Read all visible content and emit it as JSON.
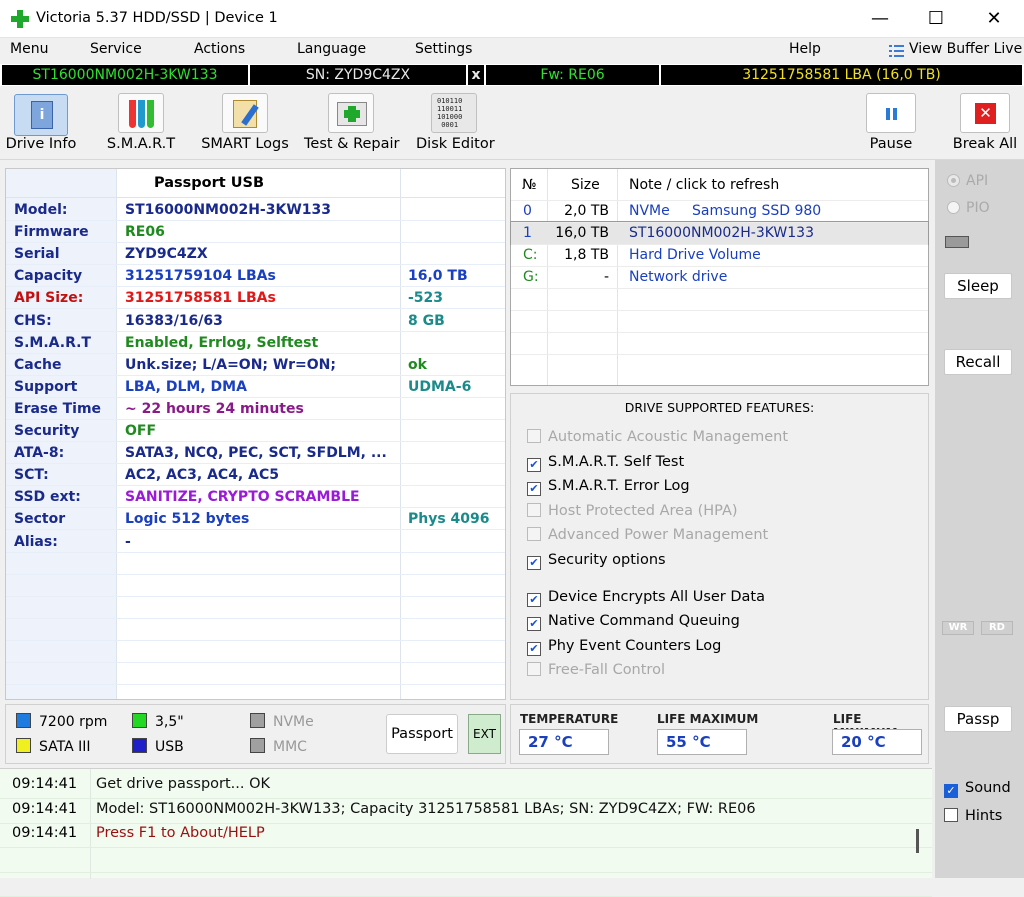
{
  "window": {
    "title": "Victoria 5.37 HDD/SSD | Device 1",
    "minimize": "—",
    "maximize": "☐",
    "close": "✕"
  },
  "menu": {
    "items": [
      "Menu",
      "Service",
      "Actions",
      "Language",
      "Settings",
      "Help"
    ],
    "view_buffer": "View Buffer Live"
  },
  "drive_strip": {
    "model": "ST16000NM002H-3KW133",
    "serial": "SN: ZYD9C4ZX",
    "close": "x",
    "firmware": "Fw: RE06",
    "capacity": "31251758581 LBA (16,0 TB)"
  },
  "toolbar": {
    "drive_info": "Drive Info",
    "smart": "S.M.A.R.T",
    "smart_logs": "SMART Logs",
    "test_repair": "Test & Repair",
    "disk_editor": "Disk Editor",
    "disk_editor_icon_text": "010110\n110011\n101000\n0001",
    "pause": "Pause",
    "break_all": "Break All"
  },
  "passport": {
    "header": "Passport USB",
    "rows": [
      {
        "key": "Model:",
        "value": "ST16000NM002H-3KW133",
        "extra": "",
        "color": "#1a2a8a",
        "extra_color": "#1a2a8a"
      },
      {
        "key": "Firmware",
        "value": "RE06",
        "extra": "",
        "color": "#1f8a1f",
        "extra_color": "#1a2a8a"
      },
      {
        "key": "Serial",
        "value": "ZYD9C4ZX",
        "extra": "",
        "color": "#1a2a8a",
        "extra_color": "#1a2a8a"
      },
      {
        "key": "Capacity",
        "value": "31251759104 LBAs",
        "extra": "16,0 TB",
        "color": "#1a3fbf",
        "extra_color": "#1a3fbf"
      },
      {
        "key": "API Size:",
        "value": "31251758581 LBAs",
        "extra": "-523",
        "color": "#e01818",
        "extra_color": "#1a8a8a",
        "key_color": "#c01010"
      },
      {
        "key": "CHS:",
        "value": "16383/16/63",
        "extra": "8 GB",
        "color": "#1a2a8a",
        "extra_color": "#1a8a8a"
      },
      {
        "key": "S.M.A.R.T",
        "value": "Enabled, Errlog, Selftest",
        "extra": "",
        "color": "#1f8a1f",
        "extra_color": "#1a2a8a"
      },
      {
        "key": "Cache",
        "value": "Unk.size; L/A=ON; Wr=ON;",
        "extra": "ok",
        "color": "#1a2a8a",
        "extra_color": "#1f8a1f"
      },
      {
        "key": "Support",
        "value": "LBA, DLM, DMA",
        "extra": "UDMA-6",
        "color": "#1a3fbf",
        "extra_color": "#1a8a8a"
      },
      {
        "key": "Erase Time",
        "value": "~ 22 hours 24 minutes",
        "extra": "",
        "color": "#8a1a8a",
        "extra_color": "#1a2a8a"
      },
      {
        "key": "Security",
        "value": "OFF",
        "extra": "",
        "color": "#1f8a1f",
        "extra_color": "#1a2a8a"
      },
      {
        "key": "ATA-8:",
        "value": "SATA3, NCQ, PEC, SCT, SFDLM, ...",
        "extra": "",
        "color": "#1a2a8a",
        "extra_color": "#1a2a8a"
      },
      {
        "key": "SCT:",
        "value": "AC2, AC3, AC4, AC5",
        "extra": "",
        "color": "#1a2a8a",
        "extra_color": "#1a2a8a"
      },
      {
        "key": "SSD ext:",
        "value": "SANITIZE, CRYPTO SCRAMBLE",
        "extra": "",
        "color": "#9a1ad8",
        "extra_color": "#1a2a8a"
      },
      {
        "key": "Sector",
        "value": "Logic 512 bytes",
        "extra": "Phys 4096",
        "color": "#1a3fbf",
        "extra_color": "#1a8a8a"
      },
      {
        "key": "Alias:",
        "value": "-",
        "extra": "",
        "color": "#1a2a8a",
        "extra_color": "#1a2a8a"
      }
    ]
  },
  "drive_list": {
    "headers": [
      "№",
      "Size",
      "Note / click to refresh"
    ],
    "rows": [
      {
        "num": "0",
        "size": "2,0 TB",
        "note": "NVMe     Samsung SSD 980",
        "num_color": "#1a3fbf",
        "note_color": "#1a3fbf"
      },
      {
        "num": "1",
        "size": "16,0 TB",
        "note": "ST16000NM002H-3KW133",
        "num_color": "#1a3fbf",
        "note_color": "#1a2a8a"
      },
      {
        "num": "C:",
        "size": "1,8 TB",
        "note": "Hard Drive Volume",
        "num_color": "#1f8a1f",
        "note_color": "#1a3fbf"
      },
      {
        "num": "G:",
        "size": "-",
        "note": "Network drive",
        "num_color": "#1f8a1f",
        "note_color": "#1a3fbf"
      }
    ]
  },
  "features": {
    "title": "DRIVE SUPPORTED FEATURES:",
    "items": [
      {
        "label": "Automatic Acoustic Management",
        "checked": false,
        "enabled": false
      },
      {
        "label": "S.M.A.R.T. Self Test",
        "checked": true,
        "enabled": true
      },
      {
        "label": "S.M.A.R.T. Error Log",
        "checked": true,
        "enabled": true
      },
      {
        "label": "Host Protected Area (HPA)",
        "checked": false,
        "enabled": false
      },
      {
        "label": "Advanced Power Management",
        "checked": false,
        "enabled": false
      },
      {
        "label": "Security options",
        "checked": true,
        "enabled": true
      },
      {
        "label": "Device Encrypts All User Data",
        "checked": true,
        "enabled": true
      },
      {
        "label": "Native Command Queuing",
        "checked": true,
        "enabled": true
      },
      {
        "label": "Phy Event Counters Log",
        "checked": true,
        "enabled": true
      },
      {
        "label": "Free-Fall Control",
        "checked": false,
        "enabled": false
      }
    ]
  },
  "side": {
    "api": "API",
    "pio": "PIO",
    "sleep": "Sleep",
    "recall": "Recall",
    "wr": "WR",
    "rd": "RD",
    "passp": "Passp"
  },
  "legend": {
    "rpm": "7200 rpm",
    "form": "3,5\"",
    "nvme": "NVMe",
    "sata": "SATA III",
    "usb": "USB",
    "mmc": "MMC",
    "passport_btn": "Passport",
    "ext_btn": "EXT",
    "colors": {
      "rpm": "#1e7be0",
      "form": "#22d822",
      "nvme": "#a0a0a0",
      "sata": "#f0f020",
      "usb": "#2020c8",
      "mmc": "#a0a0a0"
    }
  },
  "temps": {
    "temperature_label": "TEMPERATURE",
    "temperature": "27 °C",
    "life_max_label": "LIFE MAXIMUM",
    "life_max": "55 °C",
    "life_min_label": "LIFE MINIMUM",
    "life_min": "20 °C"
  },
  "log": {
    "rows": [
      {
        "time": "09:14:41",
        "text": "Get drive passport... OK",
        "color": "#111111"
      },
      {
        "time": "09:14:41",
        "text": "Model: ST16000NM002H-3KW133; Capacity 31251758581 LBAs; SN: ZYD9C4ZX; FW: RE06",
        "color": "#111111"
      },
      {
        "time": "09:14:41",
        "text": "Press F1 to About/HELP",
        "color": "#9a1010"
      }
    ],
    "sound": "Sound",
    "hints": "Hints"
  }
}
